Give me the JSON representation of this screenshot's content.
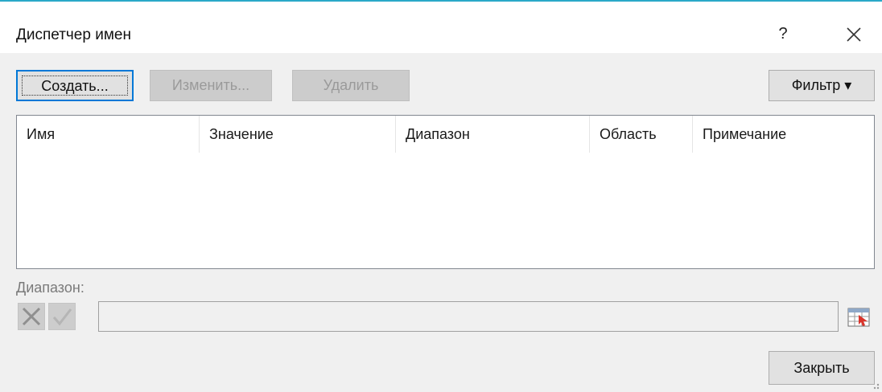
{
  "window": {
    "title": "Диспетчер имен",
    "help_label": "?",
    "accent_color": "#2aa8c8"
  },
  "toolbar": {
    "create_label": "Создать...",
    "edit_label": "Изменить...",
    "delete_label": "Удалить",
    "filter_label": "Фильтр ▾"
  },
  "list": {
    "columns": [
      "Имя",
      "Значение",
      "Диапазон",
      "Область",
      "Примечание"
    ],
    "rows": []
  },
  "range": {
    "label": "Диапазон:",
    "value": ""
  },
  "footer": {
    "close_label": "Закрыть"
  },
  "icons": {
    "close": "close-icon",
    "cancel": "cross-icon",
    "confirm": "check-icon",
    "picker": "range-picker-icon",
    "grip": "resize-grip-icon"
  }
}
